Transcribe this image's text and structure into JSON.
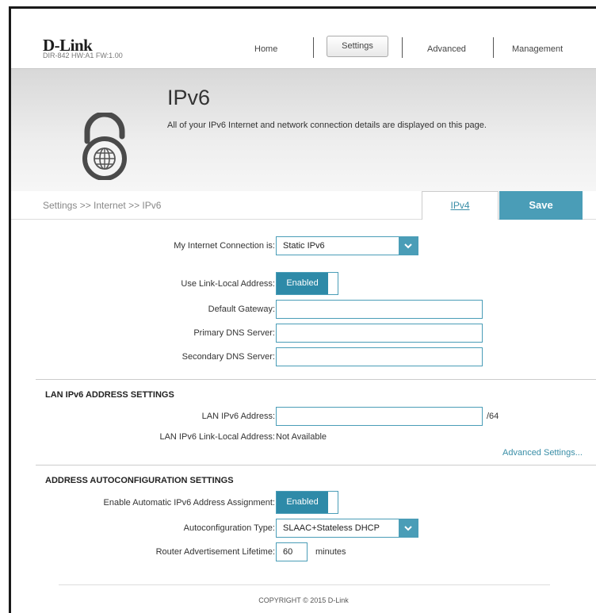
{
  "header": {
    "logo": "D-Link",
    "model": "DIR-842  HW:A1  FW:1.00",
    "nav": {
      "home": "Home",
      "settings": "Settings",
      "advanced": "Advanced",
      "management": "Management"
    }
  },
  "banner": {
    "title": "IPv6",
    "description": "All of your IPv6 Internet and network connection details are displayed on this page."
  },
  "breadcrumb": "Settings >> Internet >> IPv6",
  "tabs": {
    "ipv4": "IPv4",
    "save": "Save"
  },
  "form": {
    "connection_label": "My Internet Connection is:",
    "connection_value": "Static IPv6",
    "link_local_label": "Use Link-Local Address:",
    "link_local_value": "Enabled",
    "gateway_label": "Default Gateway:",
    "gateway_value": "",
    "primary_dns_label": "Primary DNS Server:",
    "primary_dns_value": "",
    "secondary_dns_label": "Secondary DNS Server:",
    "secondary_dns_value": ""
  },
  "lan": {
    "section_title": "LAN IPv6 ADDRESS SETTINGS",
    "address_label": "LAN IPv6 Address:",
    "address_value": "",
    "prefix_suffix": "/64",
    "link_local_label": "LAN IPv6 Link-Local Address:",
    "link_local_value": "Not Available",
    "advanced_link": "Advanced Settings..."
  },
  "autoconf": {
    "section_title": "ADDRESS AUTOCONFIGURATION SETTINGS",
    "enable_label": "Enable Automatic IPv6 Address Assignment:",
    "enable_value": "Enabled",
    "type_label": "Autoconfiguration Type:",
    "type_value": "SLAAC+Stateless DHCP",
    "lifetime_label": "Router Advertisement Lifetime:",
    "lifetime_value": "60",
    "lifetime_unit": "minutes"
  },
  "footer": "COPYRIGHT © 2015 D-Link",
  "colors": {
    "accent": "#4a9db7",
    "toggle": "#2e8aa8",
    "link": "#3a8ea7"
  }
}
